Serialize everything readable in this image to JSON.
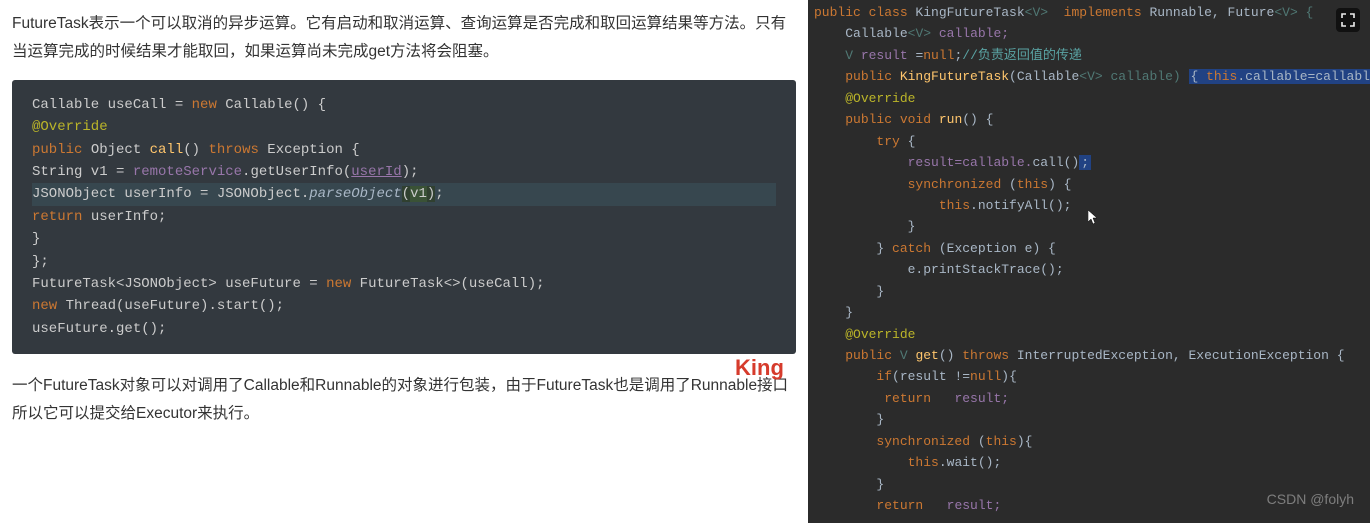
{
  "intro": "FutureTask表示一个可以取消的异步运算。它有启动和取消运算、查询运算是否完成和取回运算结果等方法。只有当运算完成的时候结果才能取回，如果运算尚未完成get方法将会阻塞。",
  "outro": "一个FutureTask对象可以对调用了Callable和Runnable的对象进行包装，由于FutureTask也是调用了Runnable接口所以它可以提交给Executor来执行。",
  "king": "King",
  "csdn": "CSDN @folyh",
  "code_left": {
    "l1a": "Callable useCall = ",
    "l1b": "new",
    "l1c": " Callable() {",
    "l2": "@Override",
    "l3a": "public",
    "l3b": " Object ",
    "l3c": "call",
    "l3d": "() ",
    "l3e": "throws",
    "l3f": " Exception {",
    "l4a": "String v1 = ",
    "l4b": "remoteService",
    "l4c": ".getUserInfo(",
    "l4d": "userId",
    "l4e": ");",
    "l5a": "JSONObject userInfo = JSONObject.",
    "l5b": "parseObject",
    "l5c": "(",
    "l5d": "v1",
    "l5e": ")",
    "l5f": ";",
    "l6a": "return",
    "l6b": " userInfo;",
    "l7": "}",
    "l8": "};",
    "l9a": "FutureTask<JSONObject> useFuture = ",
    "l9b": "new",
    "l9c": " FutureTask<>(useCall);",
    "l10a": "new",
    "l10b": " Thread(useFuture).start();",
    "l11": "useFuture.get();"
  },
  "code_right": {
    "l1a": "public class ",
    "l1b": "KingFutureTask",
    "l1c": "<",
    "l1d": "V",
    "l1e": ">  ",
    "l1f": "implements ",
    "l1g": "Runnable, Future",
    "l1h": "<",
    "l1i": "V",
    "l1j": "> {",
    "l2a": "Callable",
    "l2b": "<",
    "l2c": "V",
    "l2d": "> ",
    "l2e": "callable;",
    "l3a": "V ",
    "l3b": "result ",
    "l3c": "=",
    "l3d": "null",
    "l3e": ";",
    "l3f": "//负责返回值的传递",
    "l4a": "public ",
    "l4b": "KingFutureTask",
    "l4c": "(Callable",
    "l4d": "<",
    "l4e": "V",
    "l4f": "> callable) ",
    "l4g": "{ ",
    "l4h": "this",
    "l4i": ".callable=callable; }",
    "l5": "@Override",
    "l6a": "public void ",
    "l6b": "run",
    "l6c": "() {",
    "l7a": "try ",
    "l7b": "{",
    "l8a": "result=callable.",
    "l8b": "call",
    "l8c": "()",
    "l9a": "synchronized ",
    "l9b": "(",
    "l9c": "this",
    "l9d": ") {",
    "l10a": "this",
    "l10b": ".notifyAll();",
    "l11": "}",
    "l12a": "} ",
    "l12b": "catch ",
    "l12c": "(Exception e) {",
    "l13": "e.printStackTrace();",
    "l14": "}",
    "l15": "}",
    "l16": "@Override",
    "l17a": "public ",
    "l17b": "V ",
    "l17c": "get",
    "l17d": "() ",
    "l17e": "throws ",
    "l17f": "InterruptedException, ExecutionException {",
    "l18a": "if",
    "l18b": "(result !=",
    "l18c": "null",
    "l18d": "){",
    "l19a": "return   ",
    "l19b": "result;",
    "l20": "}",
    "l21a": "synchronized ",
    "l21b": "(",
    "l21c": "this",
    "l21d": "){",
    "l22a": "this",
    "l22b": ".wait();",
    "l23": "}",
    "l24a": "return   ",
    "l24b": "result;"
  }
}
